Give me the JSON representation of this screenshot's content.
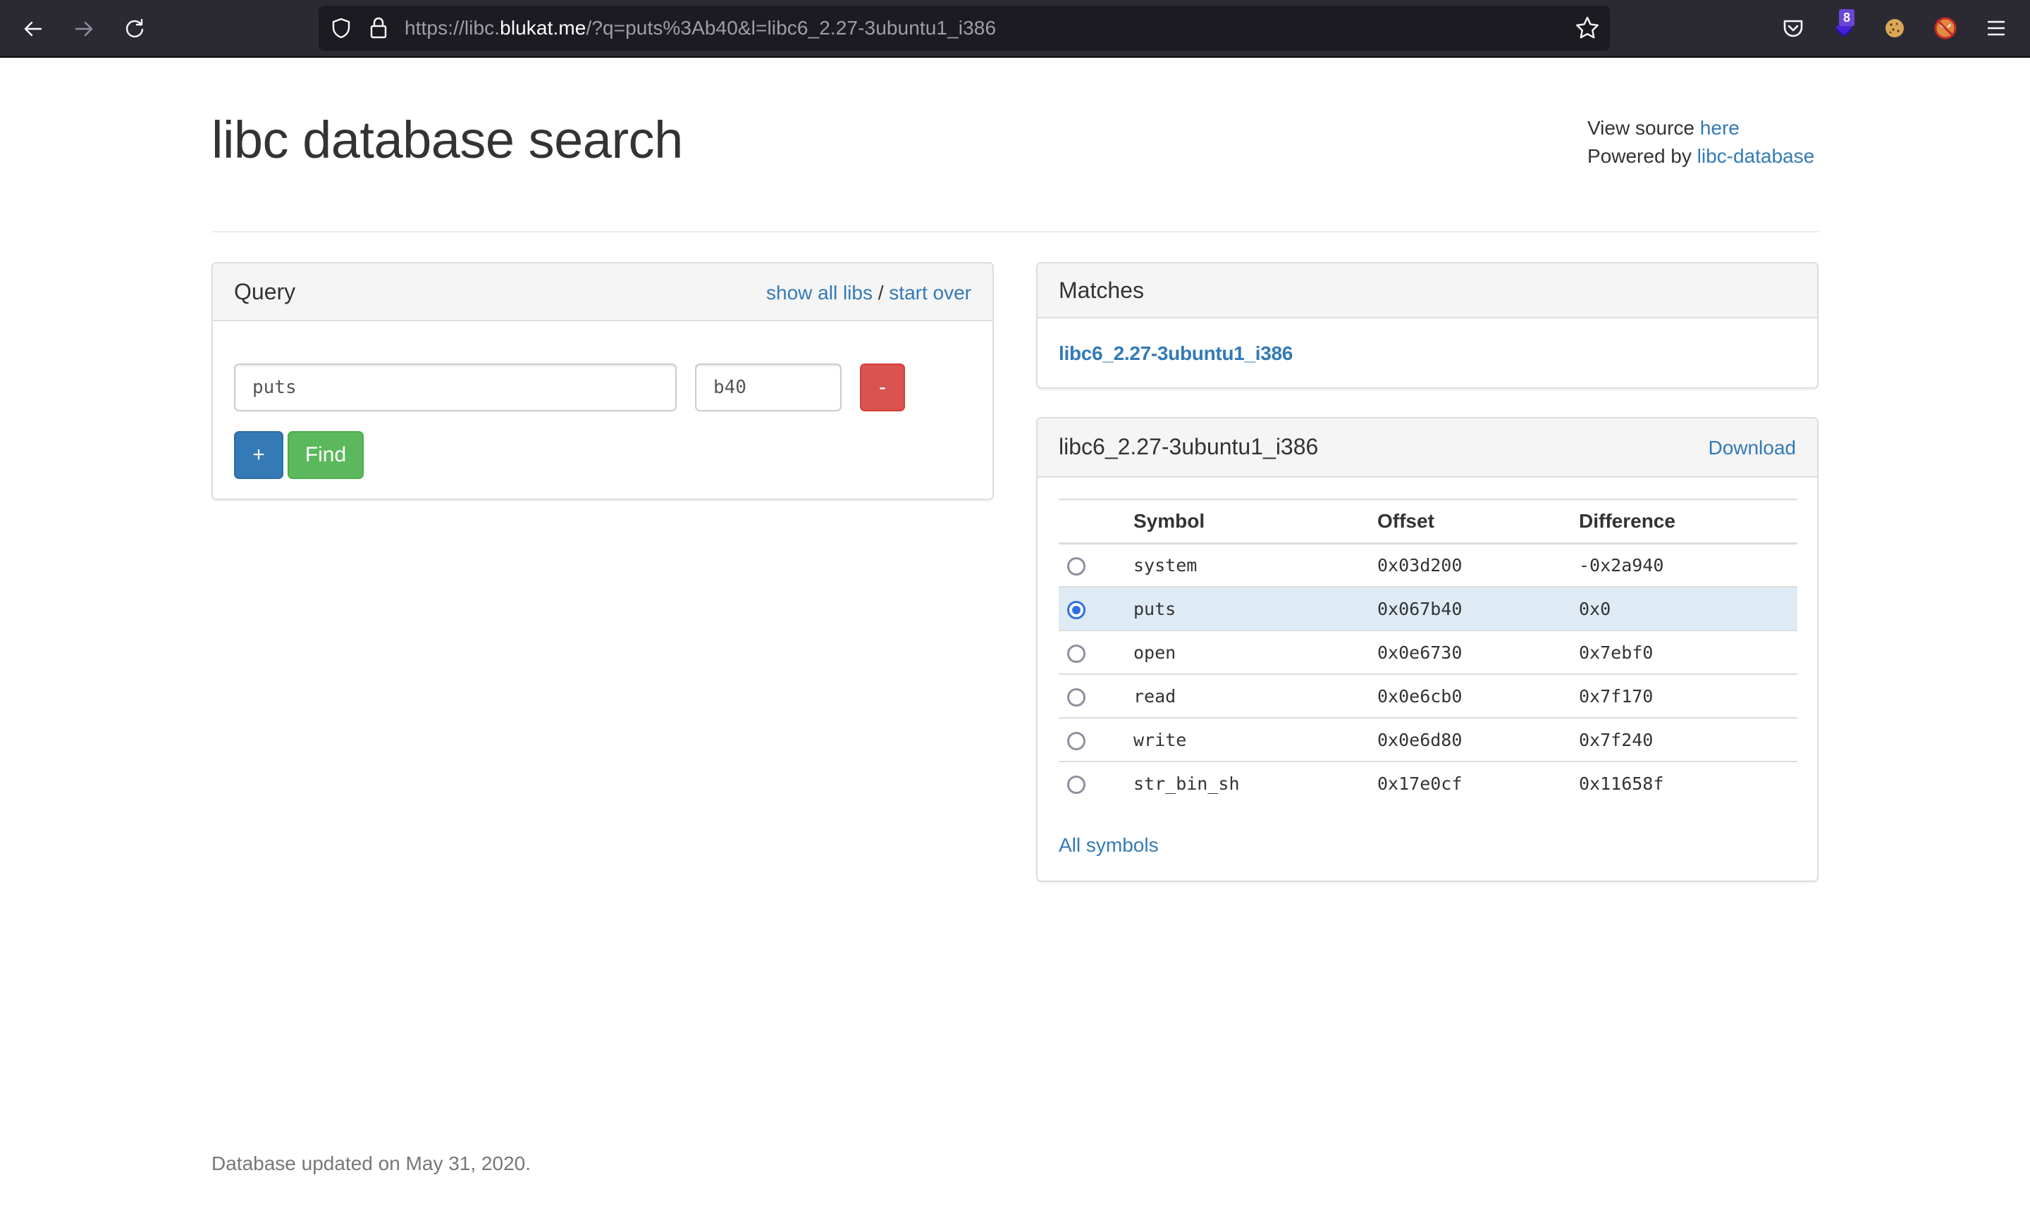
{
  "browser": {
    "url_prefix": "https://libc.",
    "url_host": "blukat.me",
    "url_suffix": "/?q=puts%3Ab40&l=libc6_2.27-3ubuntu1_i386",
    "extension_badge": "8",
    "icons": [
      "back-icon",
      "forward-icon",
      "reload-icon",
      "shield-icon",
      "lock-icon",
      "bookmark-star-icon",
      "pocket-icon",
      "extension-icon",
      "cookie-icon",
      "blocked-fox-icon",
      "menu-icon"
    ]
  },
  "header": {
    "title": "libc database search",
    "view_source_prefix": "View source ",
    "view_source_link": "here",
    "powered_by_prefix": "Powered by ",
    "powered_by_link": "libc-database"
  },
  "query": {
    "title": "Query",
    "show_all_libs": "show all libs",
    "separator": " / ",
    "start_over": "start over",
    "symbol_value": "puts",
    "offset_value": "b40",
    "remove_label": "-",
    "add_label": "+",
    "find_label": "Find"
  },
  "matches": {
    "title": "Matches",
    "items": [
      "libc6_2.27-3ubuntu1_i386"
    ]
  },
  "library": {
    "title": "libc6_2.27-3ubuntu1_i386",
    "download_label": "Download",
    "columns": [
      "",
      "Symbol",
      "Offset",
      "Difference"
    ],
    "rows": [
      {
        "symbol": "system",
        "offset": "0x03d200",
        "difference": "-0x2a940",
        "selected": false
      },
      {
        "symbol": "puts",
        "offset": "0x067b40",
        "difference": "0x0",
        "selected": true
      },
      {
        "symbol": "open",
        "offset": "0x0e6730",
        "difference": "0x7ebf0",
        "selected": false
      },
      {
        "symbol": "read",
        "offset": "0x0e6cb0",
        "difference": "0x7f170",
        "selected": false
      },
      {
        "symbol": "write",
        "offset": "0x0e6d80",
        "difference": "0x7f240",
        "selected": false
      },
      {
        "symbol": "str_bin_sh",
        "offset": "0x17e0cf",
        "difference": "0x11658f",
        "selected": false
      }
    ],
    "all_symbols_label": "All symbols"
  },
  "footer": {
    "text": "Database updated on May 31, 2020."
  },
  "colors": {
    "link": "#337ab7",
    "danger": "#d9534f",
    "primary": "#337ab7",
    "success": "#5cb85c",
    "selected_row": "#deebf5"
  }
}
